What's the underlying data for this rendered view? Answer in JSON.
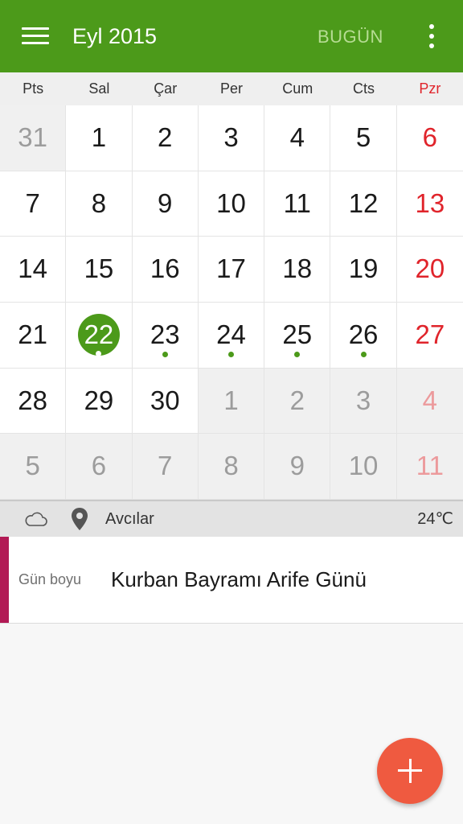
{
  "appbar": {
    "title": "Eyl 2015",
    "today_label": "BUGÜN"
  },
  "weekdays": [
    "Pts",
    "Sal",
    "Çar",
    "Per",
    "Cum",
    "Cts",
    "Pzr"
  ],
  "calendar": {
    "selected_day": 22,
    "days": [
      {
        "day": "31",
        "muted": true,
        "dot": false
      },
      {
        "day": "1",
        "muted": false,
        "dot": false
      },
      {
        "day": "2",
        "muted": false,
        "dot": false
      },
      {
        "day": "3",
        "muted": false,
        "dot": false
      },
      {
        "day": "4",
        "muted": false,
        "dot": false
      },
      {
        "day": "5",
        "muted": false,
        "dot": false
      },
      {
        "day": "6",
        "muted": false,
        "dot": false
      },
      {
        "day": "7",
        "muted": false,
        "dot": false
      },
      {
        "day": "8",
        "muted": false,
        "dot": false
      },
      {
        "day": "9",
        "muted": false,
        "dot": false
      },
      {
        "day": "10",
        "muted": false,
        "dot": false
      },
      {
        "day": "11",
        "muted": false,
        "dot": false
      },
      {
        "day": "12",
        "muted": false,
        "dot": false
      },
      {
        "day": "13",
        "muted": false,
        "dot": false
      },
      {
        "day": "14",
        "muted": false,
        "dot": false
      },
      {
        "day": "15",
        "muted": false,
        "dot": false
      },
      {
        "day": "16",
        "muted": false,
        "dot": false
      },
      {
        "day": "17",
        "muted": false,
        "dot": false
      },
      {
        "day": "18",
        "muted": false,
        "dot": false
      },
      {
        "day": "19",
        "muted": false,
        "dot": false
      },
      {
        "day": "20",
        "muted": false,
        "dot": false
      },
      {
        "day": "21",
        "muted": false,
        "dot": false
      },
      {
        "day": "22",
        "muted": false,
        "dot": true,
        "today": true
      },
      {
        "day": "23",
        "muted": false,
        "dot": true
      },
      {
        "day": "24",
        "muted": false,
        "dot": true
      },
      {
        "day": "25",
        "muted": false,
        "dot": true
      },
      {
        "day": "26",
        "muted": false,
        "dot": true
      },
      {
        "day": "27",
        "muted": false,
        "dot": false
      },
      {
        "day": "28",
        "muted": false,
        "dot": false
      },
      {
        "day": "29",
        "muted": false,
        "dot": false
      },
      {
        "day": "30",
        "muted": false,
        "dot": false
      },
      {
        "day": "1",
        "muted": true,
        "dot": false
      },
      {
        "day": "2",
        "muted": true,
        "dot": false
      },
      {
        "day": "3",
        "muted": true,
        "dot": false
      },
      {
        "day": "4",
        "muted": true,
        "dot": false
      },
      {
        "day": "5",
        "muted": true,
        "dot": false
      },
      {
        "day": "6",
        "muted": true,
        "dot": false
      },
      {
        "day": "7",
        "muted": true,
        "dot": false
      },
      {
        "day": "8",
        "muted": true,
        "dot": false
      },
      {
        "day": "9",
        "muted": true,
        "dot": false
      },
      {
        "day": "10",
        "muted": true,
        "dot": false
      },
      {
        "day": "11",
        "muted": true,
        "dot": false
      }
    ]
  },
  "weather": {
    "icon": "cloud-icon",
    "location_icon": "location-pin-icon",
    "location": "Avcılar",
    "temperature": "24℃"
  },
  "events": [
    {
      "time": "Gün boyu",
      "title": "Kurban Bayramı Arife Günü",
      "color": "#b21a55"
    }
  ],
  "fab": {
    "icon": "plus-icon"
  },
  "colors": {
    "primary": "#4c9a1a",
    "sunday": "#e0242b",
    "fab": "#ef5a40"
  }
}
